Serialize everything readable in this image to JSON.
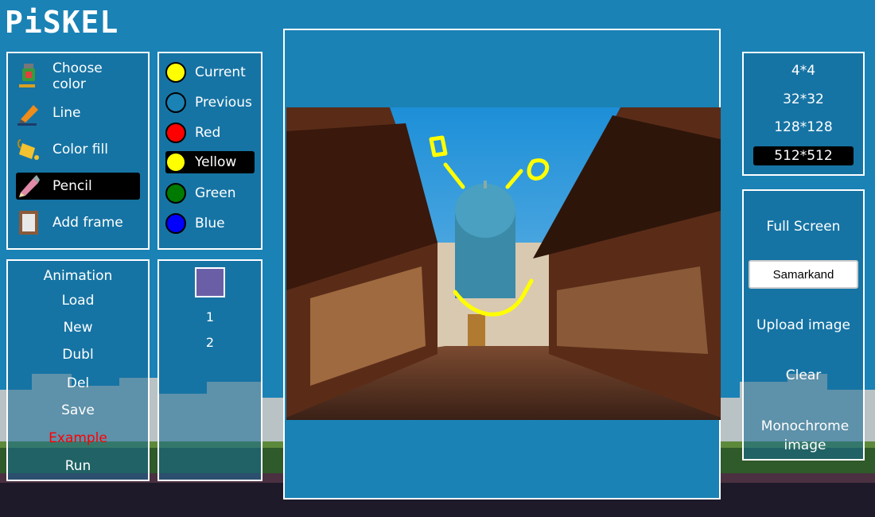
{
  "app": {
    "title": "PiSKEL"
  },
  "tools": [
    {
      "label": "Choose color",
      "icon": "color-picker-icon",
      "active": false
    },
    {
      "label": "Line",
      "icon": "marker-icon",
      "active": false
    },
    {
      "label": "Color fill",
      "icon": "paint-bucket-icon",
      "active": false
    },
    {
      "label": "Pencil",
      "icon": "pencil-icon",
      "active": true
    },
    {
      "label": "Add frame",
      "icon": "frame-icon",
      "active": false
    }
  ],
  "colors": [
    {
      "label": "Current",
      "hex": "#ffff00",
      "active": false
    },
    {
      "label": "Previous",
      "hex": "#1a82b5",
      "active": false
    },
    {
      "label": "Red",
      "hex": "#ff0000",
      "active": false
    },
    {
      "label": "Yellow",
      "hex": "#ffff00",
      "active": true
    },
    {
      "label": "Green",
      "hex": "#007a00",
      "active": false
    },
    {
      "label": "Blue",
      "hex": "#0000ff",
      "active": false
    }
  ],
  "animation": {
    "title": "Animation",
    "items": [
      {
        "label": "Load",
        "color": "#ffffff"
      },
      {
        "label": "New",
        "color": "#ffffff"
      },
      {
        "label": "Dubl",
        "color": "#ffffff"
      },
      {
        "label": "Del",
        "color": "#ffffff"
      },
      {
        "label": "Save",
        "color": "#ffffff"
      },
      {
        "label": "Example",
        "color": "#ff0000"
      },
      {
        "label": "Run",
        "color": "#ffffff"
      }
    ]
  },
  "frames": {
    "thumb_color": "#6a5fa6",
    "numbers": [
      "1",
      "2"
    ]
  },
  "sizes": [
    {
      "label": "4*4",
      "active": false
    },
    {
      "label": "32*32",
      "active": false
    },
    {
      "label": "128*128",
      "active": false
    },
    {
      "label": "512*512",
      "active": true
    }
  ],
  "right_panel": {
    "full_screen": "Full Screen",
    "title_value": "Samarkand",
    "upload": "Upload image",
    "clear": "Clear",
    "monochrome": "Monochrome image"
  },
  "canvas": {
    "drawing_color": "#ffff00"
  }
}
